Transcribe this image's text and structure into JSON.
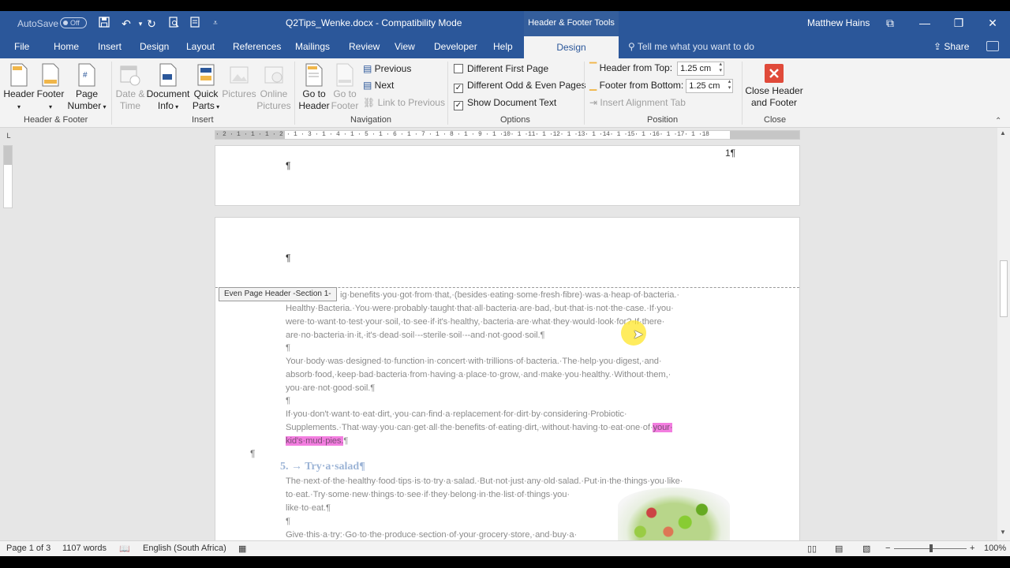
{
  "titlebar": {
    "autosave_label": "AutoSave",
    "autosave_state": "Off",
    "doc_title": "Q2Tips_Wenke.docx  -  Compatibility Mode",
    "context_tab_group": "Header & Footer Tools",
    "user_name": "Matthew Hains"
  },
  "tabs": {
    "items": [
      "File",
      "Home",
      "Insert",
      "Design",
      "Layout",
      "References",
      "Mailings",
      "Review",
      "View",
      "Developer",
      "Help"
    ],
    "active": "Design",
    "tell_me": "Tell me what you want to do",
    "share": "Share"
  },
  "ribbon": {
    "header_footer": {
      "header": "Header",
      "footer": "Footer",
      "page_number_1": "Page",
      "page_number_2": "Number",
      "label": "Header & Footer"
    },
    "insert": {
      "date_time_1": "Date &",
      "date_time_2": "Time",
      "document_info_1": "Document",
      "document_info_2": "Info",
      "quick_parts_1": "Quick",
      "quick_parts_2": "Parts",
      "pictures": "Pictures",
      "online_pictures_1": "Online",
      "online_pictures_2": "Pictures",
      "label": "Insert"
    },
    "navigation": {
      "go_to_header_1": "Go to",
      "go_to_header_2": "Header",
      "go_to_footer_1": "Go to",
      "go_to_footer_2": "Footer",
      "previous": "Previous",
      "next": "Next",
      "link_to_previous": "Link to Previous",
      "label": "Navigation"
    },
    "options": {
      "different_first_page": "Different First Page",
      "different_first_page_checked": false,
      "different_odd_even": "Different Odd & Even Pages",
      "different_odd_even_checked": true,
      "show_document_text": "Show Document Text",
      "show_document_text_checked": true,
      "label": "Options"
    },
    "position": {
      "header_from_top_label": "Header from Top:",
      "header_from_top_value": "1.25 cm",
      "footer_from_bottom_label": "Footer from Bottom:",
      "footer_from_bottom_value": "1.25 cm",
      "insert_alignment_tab": "Insert Alignment Tab",
      "label": "Position"
    },
    "close": {
      "close_header_1": "Close Header",
      "close_header_2": "and Footer",
      "label": "Close"
    }
  },
  "ruler": {
    "ticks": "· 2 · 1 · 1 · 1 · 2 · 1 · 3 · 1 · 4 · 1 · 5 · 1 · 6 · 1 · 7 · 1 · 8 · 1 · 9 · 1 ·10· 1 ·11· 1 ·12· 1 ·13· 1 ·14· 1 ·15· 1 ·16· 1 ·17· 1 ·18"
  },
  "document": {
    "page1_number": "1¶",
    "pilcrow": "¶",
    "header_tag": "Even Page Header -Section 1-",
    "para1_line1": "ig·benefits·you·got·from·that,·(besides·eating·some·fresh·fibre)·was·a·heap·of·bacteria.·",
    "para1_line2": "Healthy·Bacteria.·You·were·probably·taught·that·all·bacteria·are·bad,·but·that·is·not·the·case.·If·you·",
    "para1_line3": "were·to·want·to·test·your·soil,·to·see·if·it's·healthy,·bacteria·are·what·they·would·look·for?·If·there·",
    "para1_line4": "are·no·bacteria·in·it,·it's·dead·soil·--sterile·soil·--and·not·good·soil.¶",
    "para2_line1": "Your·body·was·designed·to·function·in·concert·with·trillions·of·bacteria.·The·help·you·digest,·and·",
    "para2_line2": "absorb·food,·keep·bad·bacteria·from·having·a·place·to·grow,·and·make·you·healthy.·Without·them,·",
    "para2_line3": "you·are·not·good·soil.¶",
    "para3_line1": "If·you·don't·want·to·eat·dirt,·you·can·find·a·replacement·for·dirt·by·considering·Probiotic·",
    "para3_line2_a": "Supplements.·That·way·you·can·get·all·the·benefits·of·eating·dirt,·without·having·to·eat·one·of·",
    "para3_line2_hl": "your·",
    "para3_line3_hl": "kid's·mud·pies.",
    "para3_line3_end": "¶",
    "heading": "5.  →  Try·a·salad¶",
    "para4_line1": "The·next·of·the·healthy·food·tips·is·to·try·a·salad.·But·not·just·any·old·salad.·Put·in·the·things·you·like·",
    "para4_line2": "to·eat.·Try·some·new·things·to·see·if·they·belong·in·the·list·of·things·you·",
    "para4_line3": "like·to·eat.¶",
    "para5_line1": "Give·this·a·try:·Go·to·the·produce·section·of·your·grocery·store,·and·buy·a·"
  },
  "statusbar": {
    "page": "Page 1 of 3",
    "words": "1107 words",
    "language": "English (South Africa)",
    "zoom": "100%"
  },
  "colors": {
    "accent": "#2b579a",
    "highlight": "#f37ee0",
    "close_red": "#e04a3a"
  }
}
